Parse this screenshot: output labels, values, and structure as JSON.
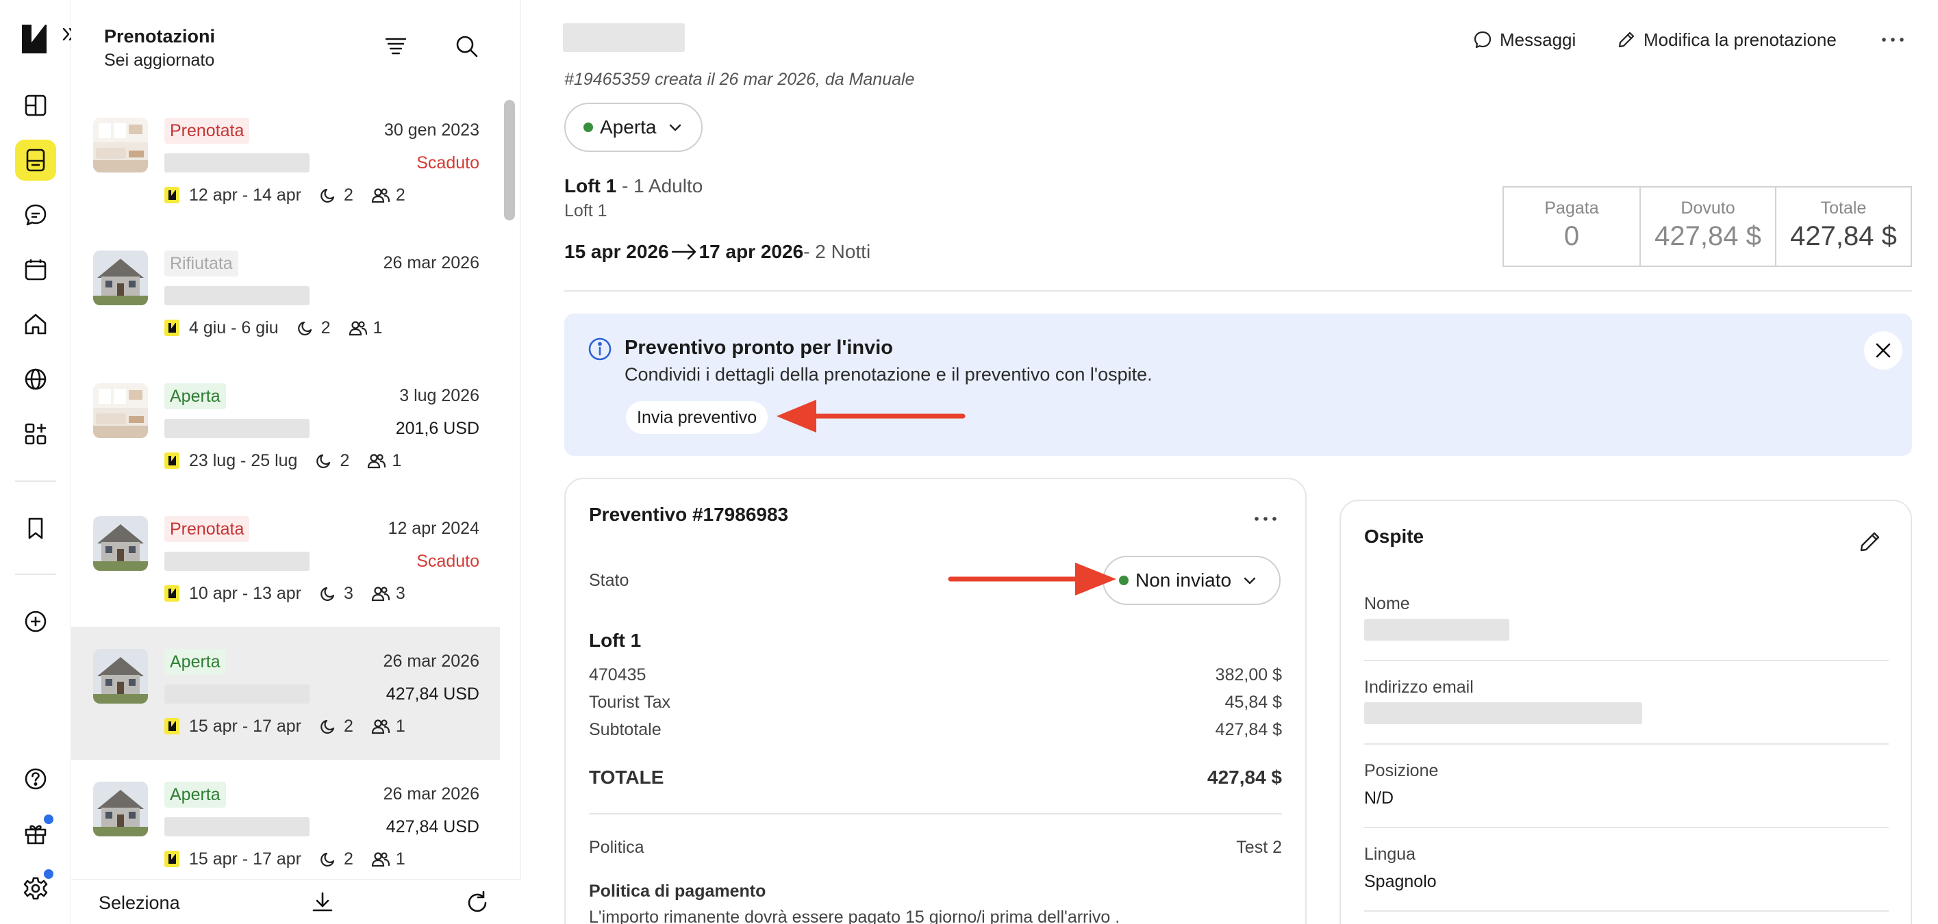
{
  "app": {
    "logo": "brand-logo"
  },
  "rail": {
    "icons": [
      "dashboard-icon",
      "bookings-icon",
      "messages-icon",
      "calendar-icon",
      "home-icon",
      "globe-icon",
      "apps-icon",
      "bookmark-icon",
      "add-circle-icon",
      "help-icon",
      "gift-icon",
      "settings-icon"
    ],
    "active": "bookings-icon"
  },
  "list": {
    "title": "Prenotazioni",
    "subtitle": "Sei aggiornato",
    "items": [
      {
        "status": "Prenotata",
        "status_color": "#c63432",
        "date": "30 gen 2023",
        "sub": "Scaduto",
        "dates": "12 apr - 14 apr",
        "nights": "2",
        "guests": "2",
        "thumb": "interior"
      },
      {
        "status": "Rifiutata",
        "status_color": "#a9a9a9",
        "date": "26 mar 2026",
        "sub": "",
        "dates": "4 giu - 6 giu",
        "nights": "2",
        "guests": "1",
        "thumb": "house"
      },
      {
        "status": "Aperta",
        "status_color": "#2e7d32",
        "date": "3 lug 2026",
        "sub": "201,6 USD",
        "dates": "23 lug - 25 lug",
        "nights": "2",
        "guests": "1",
        "thumb": "interior"
      },
      {
        "status": "Prenotata",
        "status_color": "#c63432",
        "date": "12 apr 2024",
        "sub": "Scaduto",
        "dates": "10 apr - 13 apr",
        "nights": "3",
        "guests": "3",
        "thumb": "house"
      },
      {
        "status": "Aperta",
        "status_color": "#2e7d32",
        "date": "26 mar 2026",
        "sub": "427,84 USD",
        "dates": "15 apr - 17 apr",
        "nights": "2",
        "guests": "1",
        "thumb": "house",
        "selected": true
      },
      {
        "status": "Aperta",
        "status_color": "#2e7d32",
        "date": "26 mar 2026",
        "sub": "427,84 USD",
        "dates": "15 apr - 17 apr",
        "nights": "2",
        "guests": "1",
        "thumb": "house"
      }
    ],
    "footer": {
      "select_label": "Seleziona"
    }
  },
  "header": {
    "messages_label": "Messaggi",
    "edit_label": "Modifica la prenotazione",
    "created_text": "#19465359 creata il 26 mar 2026, da Manuale",
    "status_value": "Aperta"
  },
  "booking": {
    "unit": "Loft 1",
    "occupancy": " - 1 Adulto",
    "unit_sub": "Loft 1",
    "checkin": "15 apr 2026",
    "checkout": "17 apr 2026",
    "nights": " - 2 Notti"
  },
  "totals": {
    "paid_label": "Pagata",
    "paid_value": "0",
    "due_label": "Dovuto",
    "due_value": "427,84 $",
    "total_label": "Totale",
    "total_value": "427,84 $"
  },
  "banner": {
    "title": "Preventivo pronto per l'invio",
    "text": "Condividi i dettagli della prenotazione e il preventivo con l'ospite.",
    "button": "Invia preventivo"
  },
  "quote": {
    "title": "Preventivo #17986983",
    "status_label": "Stato",
    "status_value": "Non inviato",
    "unit": "Loft 1",
    "lines": [
      {
        "label": "470435",
        "value": "382,00 $"
      },
      {
        "label": "Tourist Tax",
        "value": "45,84 $"
      },
      {
        "label": "Subtotale",
        "value": "427,84 $"
      }
    ],
    "total_label": "TOTALE",
    "total_value": "427,84 $",
    "policy_label": "Politica",
    "policy_value": "Test 2",
    "payment_policy_title": "Politica di pagamento",
    "payment_policy_text": "L'importo rimanente dovrà essere pagato 15 giorno/i prima dell'arrivo ."
  },
  "guest": {
    "title": "Ospite",
    "name_label": "Nome",
    "email_label": "Indirizzo email",
    "position_label": "Posizione",
    "position_value": "N/D",
    "language_label": "Lingua",
    "language_value": "Spagnolo"
  },
  "colors": {
    "accent": "#f7e93a",
    "open": "#3a8f3e",
    "expired": "#d23b36",
    "info_bg": "#e9effc",
    "annotation_arrow": "#e8412c"
  }
}
